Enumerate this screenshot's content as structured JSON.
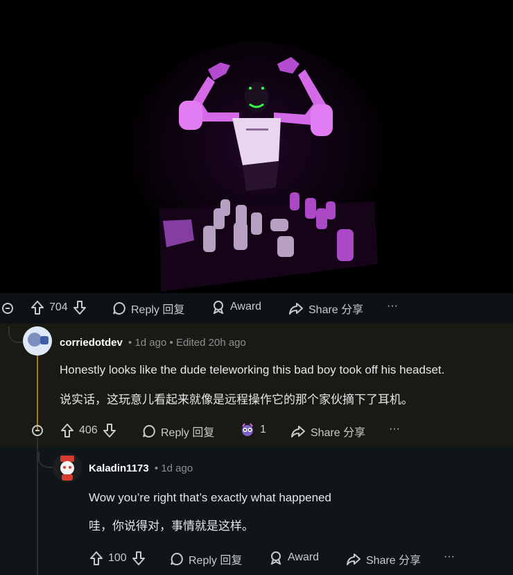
{
  "post_actions": {
    "votes": "704",
    "reply_label": "Reply 回复",
    "award_label": "Award",
    "share_label": "Share 分享",
    "more": "···"
  },
  "comment1": {
    "username": "corriedotdev",
    "time": "1d ago",
    "edited": "Edited 20h ago",
    "text_en": "Honestly looks like the dude teleworking this bad boy took off his headset.",
    "text_zh": "说实话，这玩意儿看起来就像是远程操作它的那个家伙摘下了耳机。",
    "votes": "406",
    "reply_label": "Reply 回复",
    "award_count": "1",
    "share_label": "Share 分享",
    "more": "···"
  },
  "comment2": {
    "username": "Kaladin1173",
    "time": "1d ago",
    "text_en": "Wow you’re right that’s exactly what happened",
    "text_zh": "哇，你说得对，事情就是这样。",
    "votes": "100",
    "reply_label": "Reply 回复",
    "award_label": "Award",
    "share_label": "Share 分享",
    "more": "···"
  },
  "colors": {
    "thread_highlight": "#a57a14",
    "robot_glow": "#e040fb"
  },
  "icons": [
    "upvote-icon",
    "downvote-icon",
    "comment-icon",
    "award-icon",
    "share-icon",
    "collapse-icon",
    "more-icon"
  ]
}
